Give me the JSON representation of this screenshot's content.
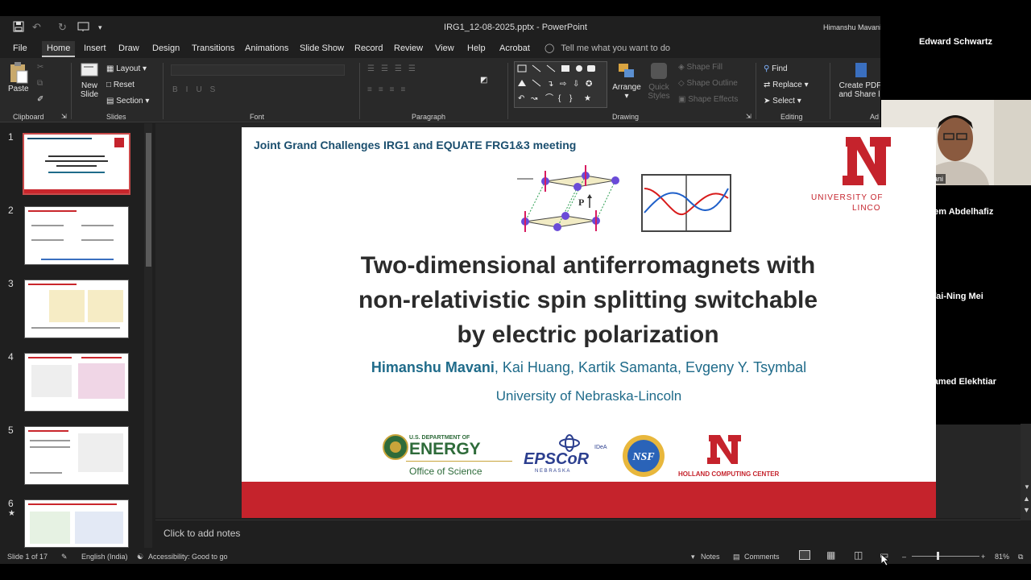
{
  "window": {
    "doc_title": "IRG1_12-08-2025.pptx  -  PowerPoint",
    "user": "Himanshu Mavani"
  },
  "menu": {
    "items": [
      "File",
      "Home",
      "Insert",
      "Draw",
      "Design",
      "Transitions",
      "Animations",
      "Slide Show",
      "Record",
      "Review",
      "View",
      "Help",
      "Acrobat"
    ],
    "tell_me": "Tell me what you want to do"
  },
  "ribbon": {
    "clipboard": {
      "paste": "Paste",
      "label": "Clipboard"
    },
    "slides": {
      "new_slide_1": "New",
      "new_slide_2": "Slide",
      "layout": "Layout",
      "reset": "Reset",
      "section": "Section",
      "label": "Slides"
    },
    "font": {
      "label": "Font"
    },
    "paragraph": {
      "label": "Paragraph"
    },
    "drawing": {
      "arrange": "Arrange",
      "quick_styles_1": "Quick",
      "quick_styles_2": "Styles",
      "shape_fill": "Shape Fill",
      "shape_outline": "Shape Outline",
      "shape_effects": "Shape Effects",
      "label": "Drawing"
    },
    "editing": {
      "find": "Find",
      "replace": "Replace",
      "select": "Select",
      "label": "Editing"
    },
    "acrobat": {
      "create_pdf_1": "Create PDF",
      "create_pdf_2": "and Share li",
      "label": "Ad"
    }
  },
  "thumbnails": [
    {
      "num": "1",
      "title": "Two-dimensional antiferromagnets with non-relativistic spin splitting switchable by electric polarization"
    },
    {
      "num": "2",
      "title": "Antiferromagnetic spintronics"
    },
    {
      "num": "3",
      "title": "Non-relativistic spin-split AFM"
    },
    {
      "num": "4",
      "title": "2D Conventional AFM / 2D Altermagnet"
    },
    {
      "num": "5",
      "title": "Sliding ferroelectricity"
    },
    {
      "num": "6",
      "title": "Spin-splitting of polar-stacked AFM bilayer"
    }
  ],
  "slide": {
    "header": "Joint Grand Challenges IRG1 and EQUATE FRG1&3 meeting",
    "title_lines": [
      "Two-dimensional antiferromagnets with",
      "non-relativistic spin splitting switchable",
      "by electric polarization"
    ],
    "presenter": "Himanshu Mavani",
    "coauthors": ", Kai Huang, Kartik Samanta, Evgeny Y. Tsymbal",
    "affiliation": "University of Nebraska-Lincoln",
    "unl_1": "UNIVERSITY OF",
    "unl_2": "LINCO",
    "logos": {
      "doe_1": "U.S. DEPARTMENT OF",
      "doe_2": "ENERGY",
      "doe_3": "Office of Science",
      "epscor_small": "IDeA",
      "epscor": "EPSCoR",
      "epscor_sub": "N E B R A S K A",
      "nsf": "NSF",
      "hcc": "HOLLAND COMPUTING CENTER"
    },
    "fig_label": "P"
  },
  "notes": {
    "placeholder": "Click to add notes"
  },
  "status": {
    "slide": "Slide 1 of 17",
    "language": "English (India)",
    "accessibility": "Accessibility: Good to go",
    "notes": "Notes",
    "comments": "Comments",
    "zoom": "81%"
  },
  "participants": [
    {
      "name": "Edward Schwartz"
    },
    {
      "name": "Hazem Abdelhafiz"
    },
    {
      "name": "Wai-Ning Mei"
    },
    {
      "name": "Mohamed Elekhtiar"
    }
  ],
  "video": {
    "label": "Himanshu Mavani"
  },
  "colors": {
    "unl_red": "#c5232c",
    "slide_blue": "#1f6b8a"
  }
}
